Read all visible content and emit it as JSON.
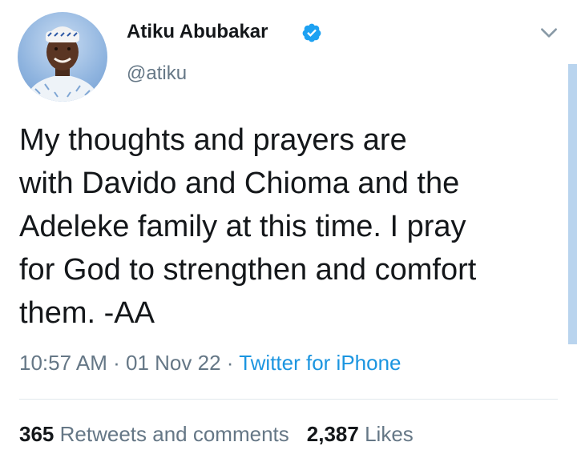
{
  "author": {
    "display_name": "Atiku Abubakar",
    "handle": "@atiku",
    "verified": true
  },
  "tweet": {
    "text": "My thoughts and prayers are\nwith Davido and Chioma and the\nAdeleke family at this time. I pray\nfor God to strengthen and comfort\nthem. -AA",
    "time": "10:57 AM",
    "separator": "·",
    "date": "01 Nov 22",
    "source": "Twitter for iPhone"
  },
  "stats": {
    "retweets_count": "365",
    "retweets_label": "Retweets and comments",
    "likes_count": "2,387",
    "likes_label": "Likes"
  },
  "icons": {
    "verified": "verified-badge-icon",
    "menu": "chevron-down-icon"
  },
  "colors": {
    "accent": "#1b95e0",
    "secondary_text": "#657786",
    "primary_text": "#14171a",
    "divider": "#e1e8ed"
  }
}
